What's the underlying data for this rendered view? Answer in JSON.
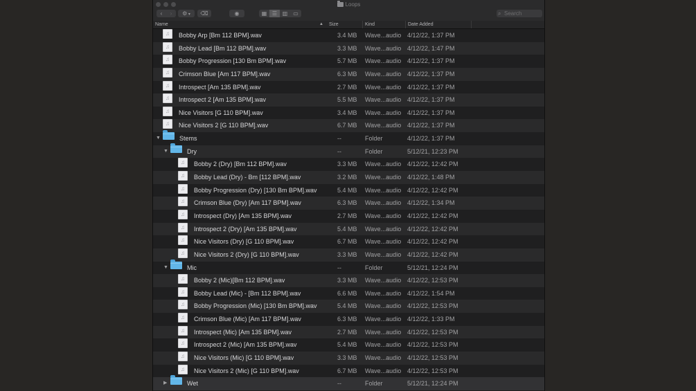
{
  "window": {
    "title": "Loops",
    "search_placeholder": "Search"
  },
  "columns": {
    "name": "Name",
    "size": "Size",
    "kind": "Kind",
    "date_added": "Date Added"
  },
  "rows": [
    {
      "level": 0,
      "type": "file",
      "name": "Bobby Arp [Bm 112 BPM].wav",
      "size": "3.4 MB",
      "kind": "Wave...audio",
      "date": "4/12/22, 1:37 PM"
    },
    {
      "level": 0,
      "type": "file",
      "name": "Bobby Lead [Bm 112 BPM].wav",
      "size": "3.3 MB",
      "kind": "Wave...audio",
      "date": "4/12/22, 1:47 PM"
    },
    {
      "level": 0,
      "type": "file",
      "name": "Bobby Progression [130 Bm BPM].wav",
      "size": "5.7 MB",
      "kind": "Wave...audio",
      "date": "4/12/22, 1:37 PM"
    },
    {
      "level": 0,
      "type": "file",
      "name": "Crimson Blue [Am 117 BPM].wav",
      "size": "6.3 MB",
      "kind": "Wave...audio",
      "date": "4/12/22, 1:37 PM"
    },
    {
      "level": 0,
      "type": "file",
      "name": "Introspect [Am 135 BPM].wav",
      "size": "2.7 MB",
      "kind": "Wave...audio",
      "date": "4/12/22, 1:37 PM"
    },
    {
      "level": 0,
      "type": "file",
      "name": "Introspect 2 [Am 135 BPM].wav",
      "size": "5.5 MB",
      "kind": "Wave...audio",
      "date": "4/12/22, 1:37 PM"
    },
    {
      "level": 0,
      "type": "file",
      "name": "Nice Visitors [G 110 BPM].wav",
      "size": "3.4 MB",
      "kind": "Wave...audio",
      "date": "4/12/22, 1:37 PM"
    },
    {
      "level": 0,
      "type": "file",
      "name": "Nice Visitors 2 [G 110 BPM].wav",
      "size": "6.7 MB",
      "kind": "Wave...audio",
      "date": "4/12/22, 1:37 PM"
    },
    {
      "level": 0,
      "type": "folder",
      "expanded": true,
      "name": "Stems",
      "size": "--",
      "kind": "Folder",
      "date": "4/12/22, 1:37 PM"
    },
    {
      "level": 1,
      "type": "folder",
      "expanded": true,
      "name": "Dry",
      "size": "--",
      "kind": "Folder",
      "date": "5/12/21, 12:23 PM"
    },
    {
      "level": 2,
      "type": "file",
      "name": "Bobby 2 (Dry) [Bm 112 BPM].wav",
      "size": "3.3 MB",
      "kind": "Wave...audio",
      "date": "4/12/22, 12:42 PM"
    },
    {
      "level": 2,
      "type": "file",
      "name": "Bobby Lead (Dry) - Bm [112 BPM].wav",
      "size": "3.2 MB",
      "kind": "Wave...audio",
      "date": "4/12/22, 1:48 PM"
    },
    {
      "level": 2,
      "type": "file",
      "name": "Bobby Progression (Dry) [130 Bm BPM].wav",
      "size": "5.4 MB",
      "kind": "Wave...audio",
      "date": "4/12/22, 12:42 PM"
    },
    {
      "level": 2,
      "type": "file",
      "name": "Crimson Blue (Dry) [Am 117 BPM].wav",
      "size": "6.3 MB",
      "kind": "Wave...audio",
      "date": "4/12/22, 1:34 PM"
    },
    {
      "level": 2,
      "type": "file",
      "name": "Introspect (Dry) [Am 135 BPM].wav",
      "size": "2.7 MB",
      "kind": "Wave...audio",
      "date": "4/12/22, 12:42 PM"
    },
    {
      "level": 2,
      "type": "file",
      "name": "Introspect 2 (Dry) [Am 135 BPM].wav",
      "size": "5.4 MB",
      "kind": "Wave...audio",
      "date": "4/12/22, 12:42 PM"
    },
    {
      "level": 2,
      "type": "file",
      "name": "Nice Visitors (Dry) [G 110 BPM].wav",
      "size": "6.7 MB",
      "kind": "Wave...audio",
      "date": "4/12/22, 12:42 PM"
    },
    {
      "level": 2,
      "type": "file",
      "name": "Nice Visitors 2 (Dry) [G 110 BPM].wav",
      "size": "3.3 MB",
      "kind": "Wave...audio",
      "date": "4/12/22, 12:42 PM"
    },
    {
      "level": 1,
      "type": "folder",
      "expanded": true,
      "name": "Mic",
      "size": "--",
      "kind": "Folder",
      "date": "5/12/21, 12:24 PM"
    },
    {
      "level": 2,
      "type": "file",
      "name": "Bobby 2 (Mic)[Bm 112 BPM].wav",
      "size": "3.3 MB",
      "kind": "Wave...audio",
      "date": "4/12/22, 12:53 PM"
    },
    {
      "level": 2,
      "type": "file",
      "name": "Bobby Lead (Mic) - [Bm 112 BPM].wav",
      "size": "6.6 MB",
      "kind": "Wave...audio",
      "date": "4/12/22, 1:54 PM"
    },
    {
      "level": 2,
      "type": "file",
      "name": "Bobby Progression (Mic) [130 Bm BPM].wav",
      "size": "5.4 MB",
      "kind": "Wave...audio",
      "date": "4/12/22, 12:53 PM"
    },
    {
      "level": 2,
      "type": "file",
      "name": "Crimson Blue (Mic) [Am 117 BPM].wav",
      "size": "6.3 MB",
      "kind": "Wave...audio",
      "date": "4/12/22, 1:33 PM"
    },
    {
      "level": 2,
      "type": "file",
      "name": "Introspect (Mic) [Am 135 BPM].wav",
      "size": "2.7 MB",
      "kind": "Wave...audio",
      "date": "4/12/22, 12:53 PM"
    },
    {
      "level": 2,
      "type": "file",
      "name": "Introspect 2 (Mic) [Am 135 BPM].wav",
      "size": "5.4 MB",
      "kind": "Wave...audio",
      "date": "4/12/22, 12:53 PM"
    },
    {
      "level": 2,
      "type": "file",
      "name": "Nice Visitors (Mic) [G 110 BPM].wav",
      "size": "3.3 MB",
      "kind": "Wave...audio",
      "date": "4/12/22, 12:53 PM"
    },
    {
      "level": 2,
      "type": "file",
      "name": "Nice Visitors 2 (Mic) [G 110 BPM].wav",
      "size": "6.7 MB",
      "kind": "Wave...audio",
      "date": "4/12/22, 12:53 PM"
    },
    {
      "level": 1,
      "type": "folder",
      "expanded": false,
      "selected": true,
      "name": "Wet",
      "size": "--",
      "kind": "Folder",
      "date": "5/12/21, 12:24 PM"
    }
  ]
}
